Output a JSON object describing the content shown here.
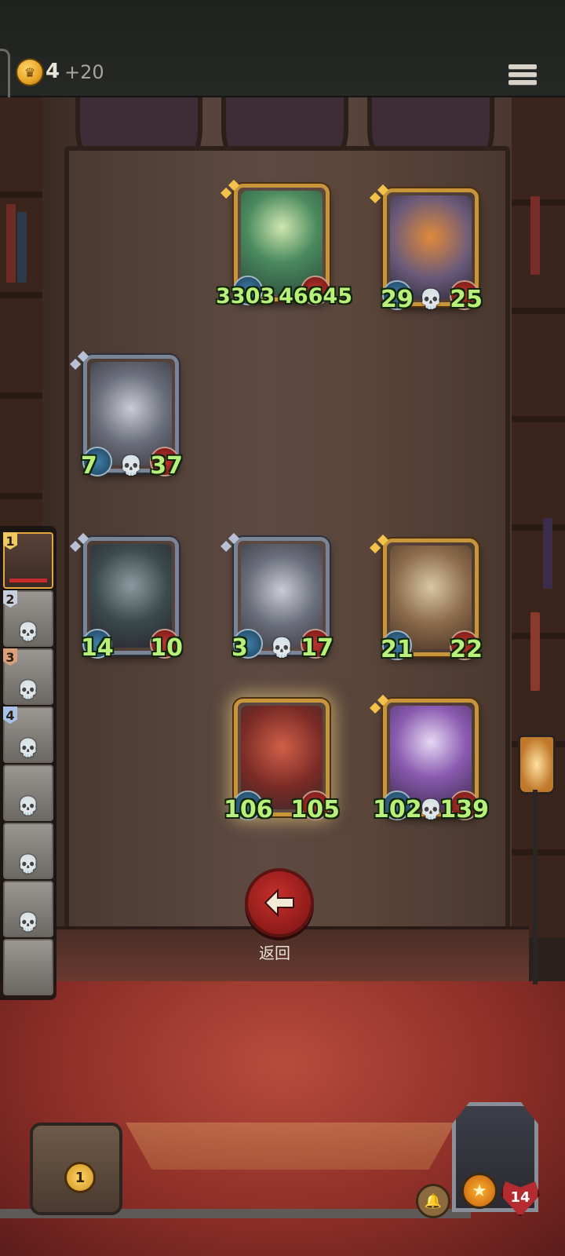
{
  "header": {
    "gold": "4",
    "gold_income": "+20"
  },
  "board": {
    "cards": [
      {
        "id": "fairy",
        "atk": "3303",
        "hp": "46645",
        "frame": "gold"
      },
      {
        "id": "pumpkin-knight",
        "atk": "29",
        "hp": "25",
        "frame": "gold"
      },
      {
        "id": "robot-bell-1",
        "atk": "7",
        "hp": "37",
        "frame": "silver"
      },
      {
        "id": "horned-witch",
        "atk": "14",
        "hp": "10",
        "frame": "silver"
      },
      {
        "id": "robot-bell-2",
        "atk": "3",
        "hp": "17",
        "frame": "silver"
      },
      {
        "id": "airship",
        "atk": "21",
        "hp": "22",
        "frame": "gold"
      },
      {
        "id": "red-dragon",
        "atk": "106",
        "hp": "105",
        "frame": "gold"
      },
      {
        "id": "cannon",
        "atk": "102",
        "hp": "139",
        "frame": "gold"
      }
    ]
  },
  "roster": {
    "slots": [
      {
        "rank": "1"
      },
      {
        "rank": "2"
      },
      {
        "rank": "3"
      },
      {
        "rank": "4"
      }
    ]
  },
  "back_button": {
    "label": "返回"
  },
  "footer": {
    "chest_count": "1",
    "hero_hp": "14"
  },
  "colors": {
    "gold_frame": "#c9953a",
    "silver_frame": "#7b8396",
    "stat_green": "#b8f07a",
    "back_red": "#c7302c"
  }
}
